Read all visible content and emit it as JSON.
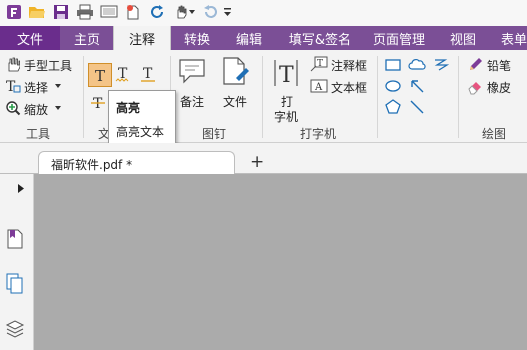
{
  "menu": {
    "file": "文件",
    "tabs": [
      "主页",
      "注释",
      "转换",
      "编辑",
      "填写&签名",
      "页面管理",
      "视图",
      "表单"
    ],
    "active_tab": "注释"
  },
  "ribbon": {
    "tools": {
      "hand": "手型工具",
      "select": "选择",
      "zoom": "缩放",
      "group": "工具"
    },
    "text_markup": {
      "group_partial": "文"
    },
    "pin": {
      "note": "备注",
      "file": "文件",
      "group": "图钉"
    },
    "typewriter": {
      "typewriter_line1": "打",
      "typewriter_line2": "字机",
      "callout": "注释框",
      "textbox": "文本框",
      "group": "打字机"
    },
    "drawing": {
      "pencil": "铅笔",
      "eraser": "橡皮",
      "group": "绘图"
    }
  },
  "tooltip": {
    "title": "高亮",
    "desc": "高亮文本"
  },
  "document": {
    "tab_name": "福昕软件.pdf *",
    "new_tab": "+"
  },
  "colors": {
    "menubar": "#7b4f96",
    "file_menu": "#6a2d8c",
    "doc_background": "#ababab",
    "highlight_icon": "#f4c487"
  }
}
